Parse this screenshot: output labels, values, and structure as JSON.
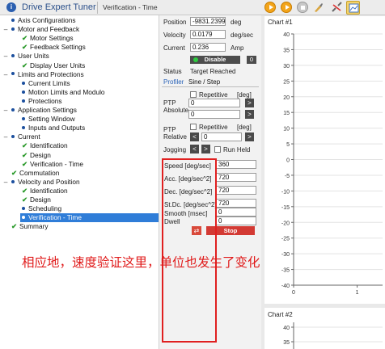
{
  "titlebar": {
    "app_title": "Drive Expert Tuner",
    "active_tab": "Verification - Time"
  },
  "tree": {
    "items": [
      {
        "label": "Axis Configurations",
        "level": 1,
        "marker": "bullet",
        "expander": ""
      },
      {
        "label": "Motor and Feedback",
        "level": 1,
        "marker": "bullet",
        "expander": "–"
      },
      {
        "label": "Motor Settings",
        "level": 2,
        "marker": "check",
        "expander": ""
      },
      {
        "label": "Feedback Settings",
        "level": 2,
        "marker": "check",
        "expander": ""
      },
      {
        "label": "User Units",
        "level": 1,
        "marker": "bullet",
        "expander": "–"
      },
      {
        "label": "Display User Units",
        "level": 2,
        "marker": "check",
        "expander": ""
      },
      {
        "label": "Limits and Protections",
        "level": 1,
        "marker": "bullet",
        "expander": "–"
      },
      {
        "label": "Current Limits",
        "level": 2,
        "marker": "bullet",
        "expander": ""
      },
      {
        "label": "Motion Limits and Modulo",
        "level": 2,
        "marker": "bullet",
        "expander": ""
      },
      {
        "label": "Protections",
        "level": 2,
        "marker": "bullet",
        "expander": ""
      },
      {
        "label": "Application Settings",
        "level": 1,
        "marker": "bullet",
        "expander": "–"
      },
      {
        "label": "Setting Window",
        "level": 2,
        "marker": "bullet",
        "expander": ""
      },
      {
        "label": "Inputs and Outputs",
        "level": 2,
        "marker": "bullet",
        "expander": ""
      },
      {
        "label": "Current",
        "level": 1,
        "marker": "bullet",
        "expander": "–"
      },
      {
        "label": "Identification",
        "level": 2,
        "marker": "check",
        "expander": ""
      },
      {
        "label": "Design",
        "level": 2,
        "marker": "check",
        "expander": ""
      },
      {
        "label": "Verification - Time",
        "level": 2,
        "marker": "check",
        "expander": ""
      },
      {
        "label": "Commutation",
        "level": 1,
        "marker": "check",
        "expander": ""
      },
      {
        "label": "Velocity and Position",
        "level": 1,
        "marker": "bullet",
        "expander": "–"
      },
      {
        "label": "Identification",
        "level": 2,
        "marker": "check",
        "expander": ""
      },
      {
        "label": "Design",
        "level": 2,
        "marker": "check",
        "expander": ""
      },
      {
        "label": "Scheduling",
        "level": 2,
        "marker": "bullet",
        "expander": ""
      },
      {
        "label": "Verification - Time",
        "level": 2,
        "marker": "bullet",
        "expander": "",
        "selected": true
      },
      {
        "label": "Summary",
        "level": 1,
        "marker": "check",
        "expander": ""
      }
    ]
  },
  "status": {
    "position_label": "Position",
    "position_value": "-9831.2399",
    "position_unit": "deg",
    "velocity_label": "Velocity",
    "velocity_value": "0.0179",
    "velocity_unit": "deg/sec",
    "current_label": "Current",
    "current_value": "0.236",
    "current_unit": "Amp",
    "disable_label": "Disable",
    "zero_badge": "0",
    "status_label": "Status",
    "status_value": "Target Reached"
  },
  "tabs": {
    "profiler": "Profiler",
    "sine_step": "Sine / Step"
  },
  "ptp_absolute": {
    "label_line1": "PTP",
    "label_line2": "Absolute",
    "repetitive_label": "Repetitive",
    "unit": "[deg]",
    "value1": "0",
    "value2": "0",
    "arrow": ">"
  },
  "ptp_relative": {
    "label_line1": "PTP",
    "label_line2": "Relative",
    "repetitive_label": "Repetitive",
    "unit": "[deg]",
    "left_arrow": "<",
    "right_arrow": ">",
    "value": "0"
  },
  "jogging": {
    "label": "Jogging",
    "left_arrow": "<",
    "right_arrow": ">",
    "run_held_label": "Run Held"
  },
  "params": {
    "speed_label": "Speed [deg/sec]",
    "speed_value": "360",
    "acc_label": "Acc. [deg/sec^2]",
    "acc_value": "720",
    "dec_label": "Dec. [deg/sec^2]",
    "dec_value": "720",
    "stdc_label": "St.Dc. [deg/sec^2]",
    "stdc_value": "720",
    "smooth_label": "Smooth [msec]",
    "smooth_value": "0",
    "dwell_label": "Dwell",
    "dwell_value": "0",
    "stop_label": "Stop"
  },
  "annotation": "相应地，速度验证这里，单位也发生了变化",
  "chart_data": [
    {
      "type": "line",
      "title": "Chart #1",
      "ylim": [
        -40,
        40
      ],
      "yticks": [
        40,
        35,
        30,
        25,
        20,
        15,
        10,
        5,
        0,
        -5,
        -10,
        -15,
        -20,
        -25,
        -30,
        -35,
        -40
      ],
      "xlim": [
        0,
        1.4
      ],
      "xticks": [
        0,
        1
      ],
      "grid": true,
      "series": []
    },
    {
      "type": "line",
      "title": "Chart #2",
      "ylim": [
        35,
        40
      ],
      "yticks": [
        40,
        35
      ],
      "grid": true,
      "series": []
    }
  ]
}
